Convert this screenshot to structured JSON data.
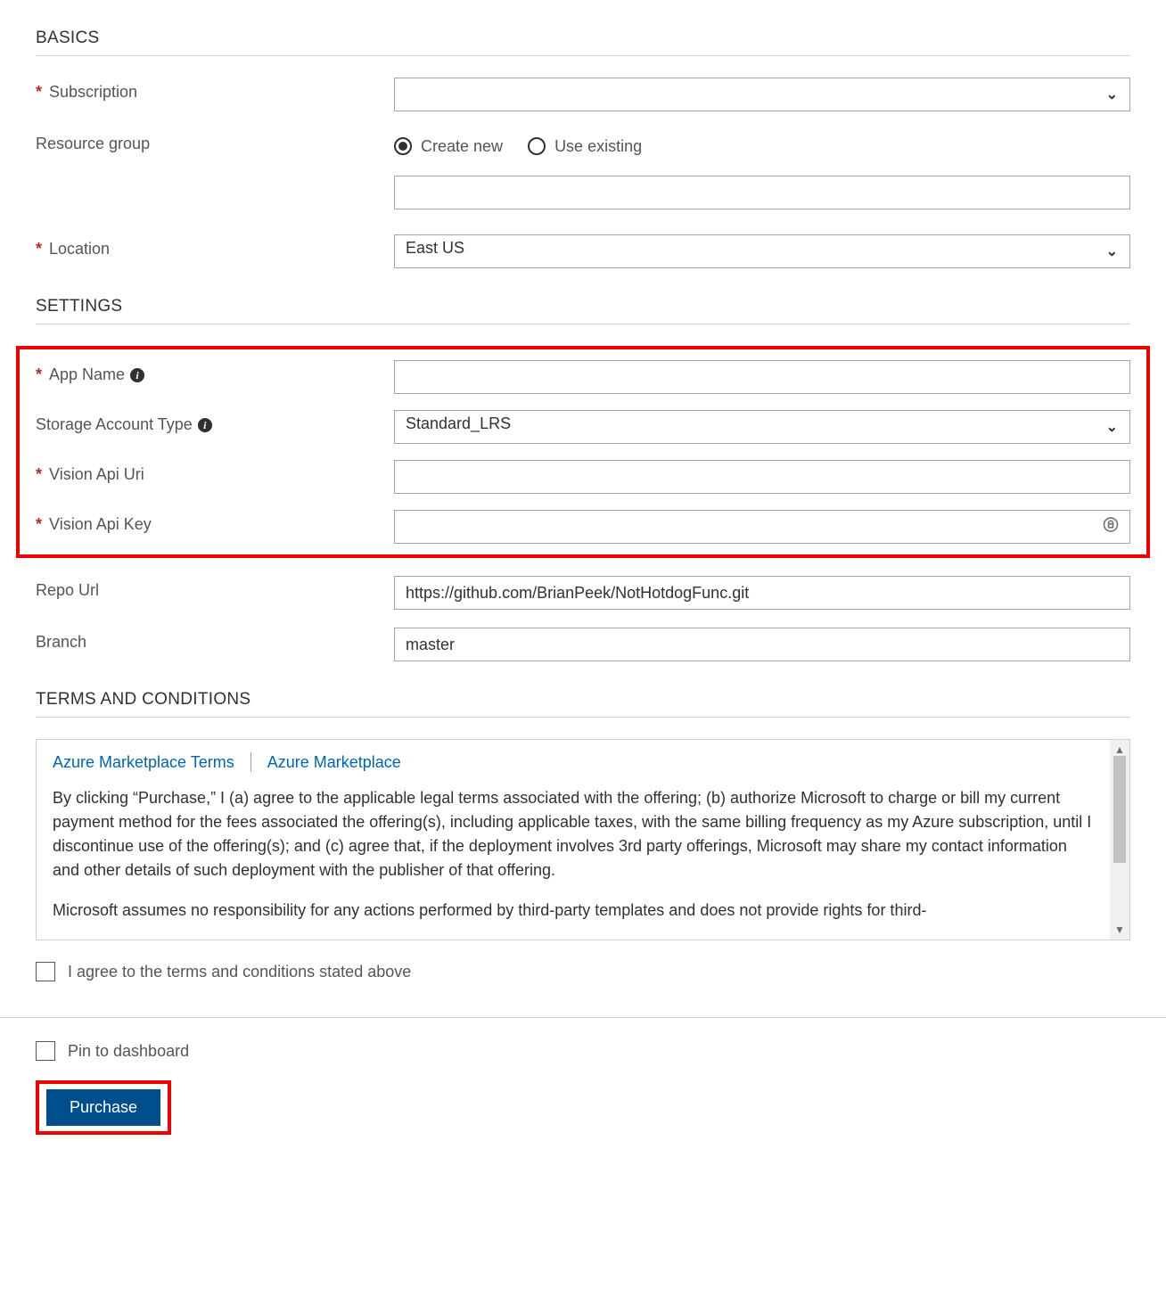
{
  "basics": {
    "title": "BASICS",
    "subscription": {
      "label": "Subscription",
      "value": "            "
    },
    "resource_group": {
      "label": "Resource group",
      "create_new": "Create new",
      "use_existing": "Use existing",
      "selected": "create_new",
      "input_value": ""
    },
    "location": {
      "label": "Location",
      "value": "East US"
    }
  },
  "settings": {
    "title": "SETTINGS",
    "app_name": {
      "label": "App Name",
      "value": ""
    },
    "storage_type": {
      "label": "Storage Account Type",
      "value": "Standard_LRS"
    },
    "vision_uri": {
      "label": "Vision Api Uri",
      "value": ""
    },
    "vision_key": {
      "label": "Vision Api Key",
      "value": ""
    },
    "repo_url": {
      "label": "Repo Url",
      "value": "https://github.com/BrianPeek/NotHotdogFunc.git"
    },
    "branch": {
      "label": "Branch",
      "value": "master"
    }
  },
  "terms": {
    "title": "TERMS AND CONDITIONS",
    "link1": "Azure Marketplace Terms",
    "link2": "Azure Marketplace",
    "body1": "By clicking “Purchase,” I (a) agree to the applicable legal terms associated with the offering; (b) authorize Microsoft to charge or bill my current payment method for the fees associated the offering(s), including applicable taxes, with the same billing frequency as my Azure subscription, until I discontinue use of the offering(s); and (c) agree that, if the deployment involves 3rd party offerings, Microsoft may share my contact information and other details of such deployment with the publisher of that offering.",
    "body2": "Microsoft assumes no responsibility for any actions performed by third-party templates and does not provide rights for third-",
    "agree_label": "I agree to the terms and conditions stated above"
  },
  "footer": {
    "pin_label": "Pin to dashboard",
    "purchase_label": "Purchase"
  }
}
